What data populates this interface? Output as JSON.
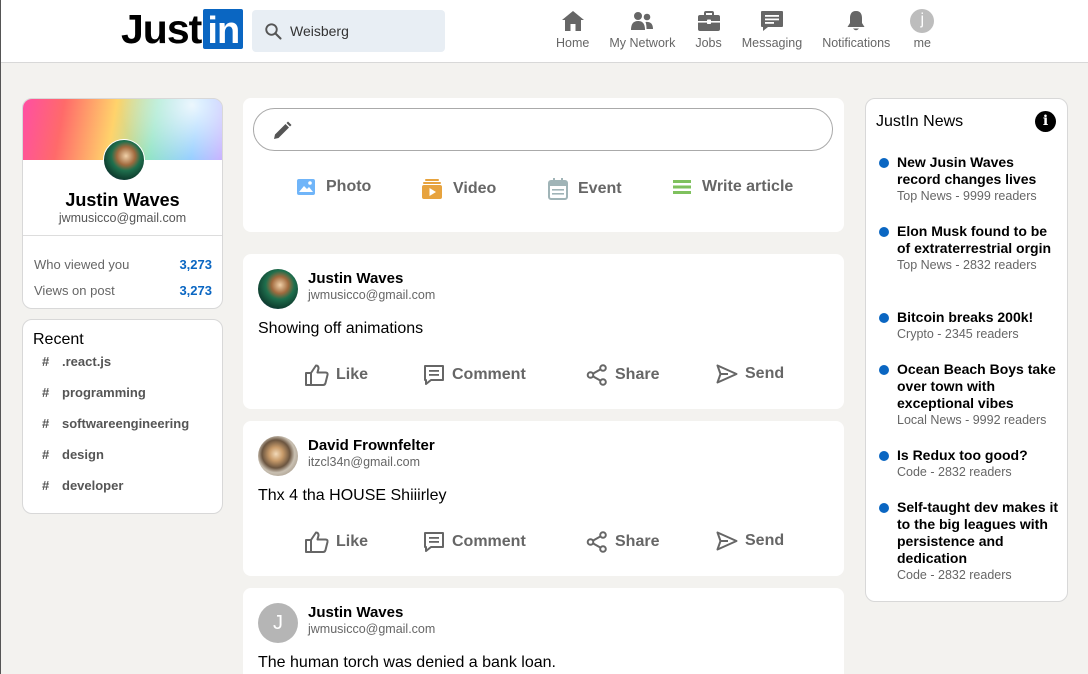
{
  "header": {
    "logo_text": "Just",
    "logo_box": "in",
    "search": {
      "value": "Weisberg",
      "placeholder": ""
    },
    "nav": [
      {
        "label": "Home",
        "icon": "home-icon"
      },
      {
        "label": "My Network",
        "icon": "network-icon"
      },
      {
        "label": "Jobs",
        "icon": "briefcase-icon"
      },
      {
        "label": "Messaging",
        "icon": "messaging-icon"
      },
      {
        "label": "Notifications",
        "icon": "bell-icon"
      },
      {
        "label": "me",
        "icon": "avatar",
        "avatar_letter": "j"
      }
    ]
  },
  "profile": {
    "name": "Justin Waves",
    "email": "jwmusicco@gmail.com",
    "stats": [
      {
        "label": "Who viewed you",
        "value": "3,273"
      },
      {
        "label": "Views on post",
        "value": "3,273"
      }
    ]
  },
  "recent": {
    "title": "Recent",
    "hash": "#",
    "items": [
      ".react.js",
      "programming",
      "softwareengineering",
      "design",
      "developer"
    ]
  },
  "share": {
    "input_value": "",
    "actions": [
      {
        "label": "Photo",
        "icon": "photo-icon",
        "color": "#70b5f9"
      },
      {
        "label": "Video",
        "icon": "video-icon",
        "color": "#e7a33e"
      },
      {
        "label": "Event",
        "icon": "calendar-icon",
        "color": "#a0b4b7"
      },
      {
        "label": "Write article",
        "icon": "article-icon",
        "color": "#7fc15e"
      }
    ]
  },
  "post_actions": [
    {
      "label": "Like",
      "icon": "thumbs-up-icon"
    },
    {
      "label": "Comment",
      "icon": "comment-icon"
    },
    {
      "label": "Share",
      "icon": "share-icon"
    },
    {
      "label": "Send",
      "icon": "send-icon"
    }
  ],
  "posts": [
    {
      "name": "Justin Waves",
      "email": "jwmusicco@gmail.com",
      "text": "Showing off animations"
    },
    {
      "name": "David Frownfelter",
      "email": "itzcl34n@gmail.com",
      "text": "Thx 4 tha HOUSE Shiiirley"
    },
    {
      "name": "Justin Waves",
      "email": "jwmusicco@gmail.com",
      "text": "The human torch was denied a bank loan.",
      "avatar_letter": "J"
    }
  ],
  "news": {
    "title": "JustIn News",
    "info": "i",
    "items": [
      {
        "headline": "New Jusin Waves record changes lives",
        "sub": "Top News - 9999 readers"
      },
      {
        "headline": "Elon Musk found to be of extraterrestrial orgin",
        "sub": "Top News - 2832 readers"
      },
      {
        "headline": "Bitcoin breaks 200k!",
        "sub": "Crypto - 2345 readers"
      },
      {
        "headline": "Ocean Beach Boys take over town with exceptional vibes",
        "sub": "Local News - 9992 readers"
      },
      {
        "headline": "Is Redux too good?",
        "sub": "Code - 2832 readers"
      },
      {
        "headline": "Self-taught dev makes it to the big leagues with persistence and dedication",
        "sub": "Code - 2832 readers"
      }
    ]
  },
  "colors": {
    "accent": "#0a66c2",
    "background": "#f3f2ef"
  }
}
